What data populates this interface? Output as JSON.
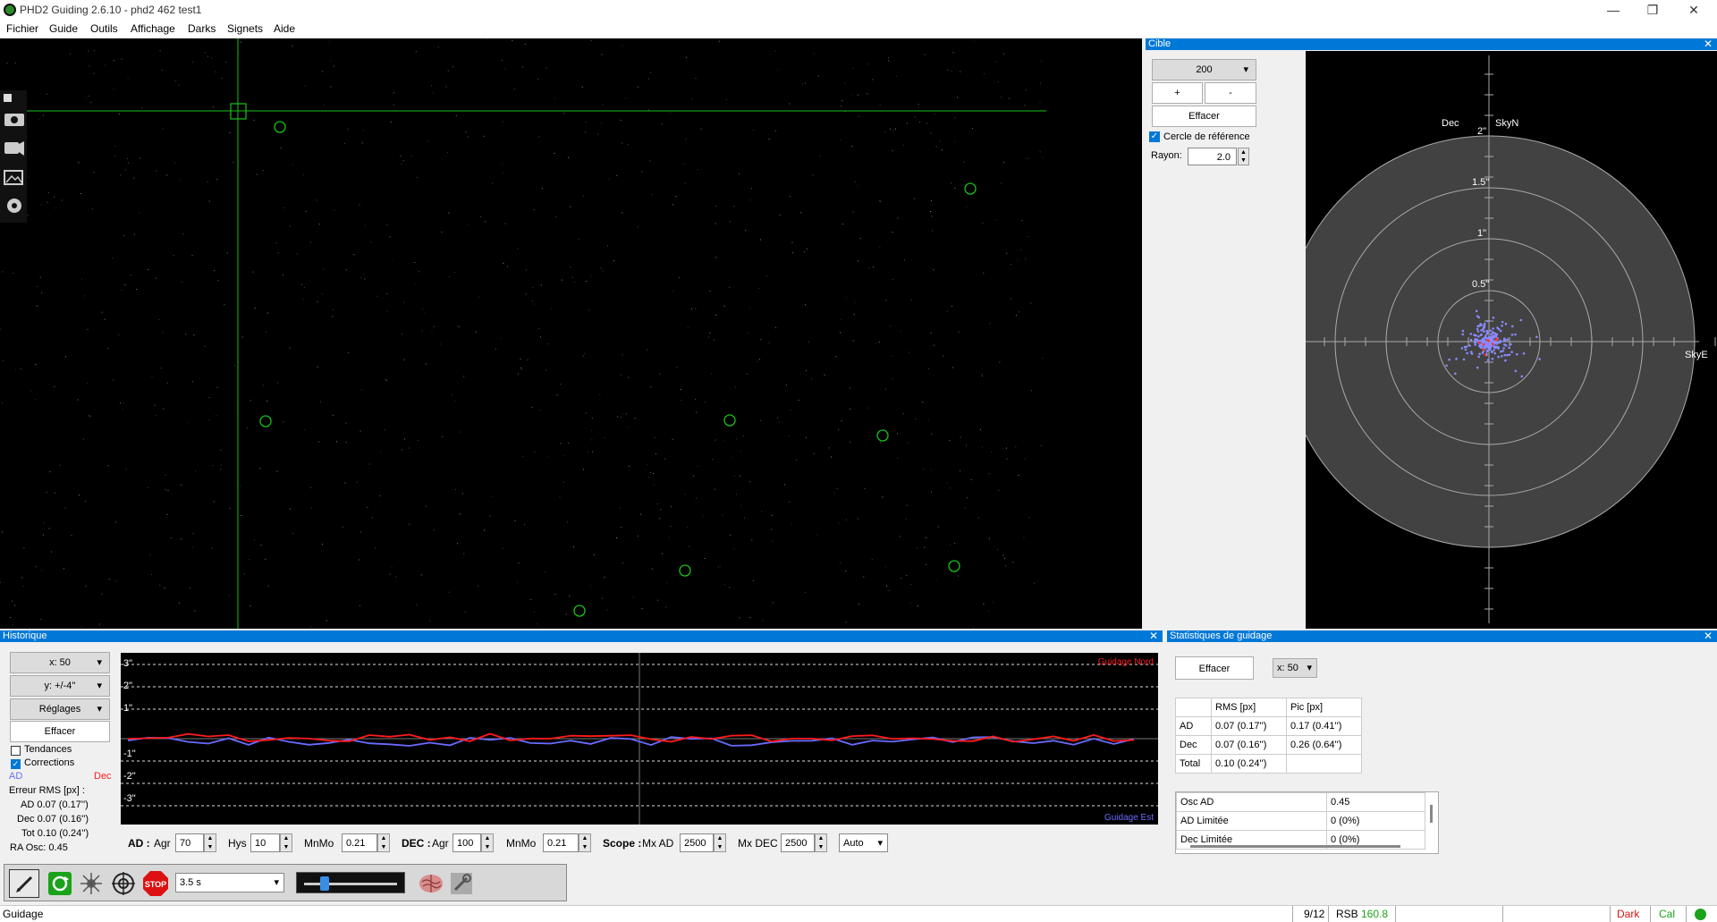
{
  "window": {
    "title": "PHD2 Guiding 2.6.10 - phd2 462 test1",
    "minimize": "—",
    "restore": "❐",
    "close": "✕"
  },
  "menu": [
    "Fichier",
    "Guide",
    "Outils",
    "Affichage",
    "Darks",
    "Signets",
    "Aide"
  ],
  "target": {
    "title": "Cible",
    "scale_value": "200",
    "plus_label": "+",
    "minus_label": "-",
    "clear_label": "Effacer",
    "ref_circle_label": "Cercle de référence",
    "ref_circle_checked": true,
    "radius_label": "Rayon:",
    "radius_value": "2.0",
    "labels": {
      "dec": "Dec",
      "skyn": "SkyN",
      "ad": "AD",
      "skye": "SkyE"
    },
    "rings": [
      "2\"",
      "1.5\"",
      "1\"",
      "0.5\""
    ]
  },
  "history": {
    "title": "Historique",
    "x_select": "x:  50",
    "y_select": "y: +/-4''",
    "settings_label": "Réglages",
    "clear_label": "Effacer",
    "trends_label": "Tendances",
    "trends_checked": false,
    "corrections_label": "Corrections",
    "corrections_checked": true,
    "legend_ad": "AD",
    "legend_dec": "Dec",
    "rms_title": "Erreur RMS [px] :",
    "rms_ad": "AD  0.07 (0.17'')",
    "rms_dec": "Dec  0.07 (0.16'')",
    "rms_tot": "Tot  0.10 (0.24'')",
    "ra_osc": "RA Osc: 0.45",
    "y_ticks": [
      "3\"",
      "2\"",
      "1\"",
      "-1\"",
      "-2\"",
      "-3\""
    ],
    "north_label": "Guidage Nord",
    "east_label": "Guidage Est",
    "colors": {
      "ra": "#6b6bff",
      "dec": "#ff1a1a"
    }
  },
  "params": {
    "ad_label": "AD :",
    "agr_label": "Agr",
    "ad_agr": "70",
    "hys_label": "Hys",
    "hys": "10",
    "mnmo_label": "MnMo",
    "ad_mnmo": "0.21",
    "dec_label": "DEC :",
    "dec_agr": "100",
    "dec_mnmo": "0.21",
    "scope_label": "Scope :",
    "mxad_label": "Mx AD",
    "mxad": "2500",
    "mxdec_label": "Mx DEC",
    "mxdec": "2500",
    "mode": "Auto"
  },
  "stats": {
    "title": "Statistiques de guidage",
    "clear_label": "Effacer",
    "x_select": "x: 50",
    "headers": [
      "",
      "RMS [px]",
      "Pic [px]"
    ],
    "rows": [
      [
        "AD",
        "0.07 (0.17'')",
        "0.17 (0.41'')"
      ],
      [
        "Dec",
        "0.07 (0.16'')",
        "0.26 (0.64'')"
      ],
      [
        "Total",
        "0.10 (0.24'')",
        ""
      ]
    ],
    "osc_rows": [
      [
        "Osc AD",
        "0.45"
      ],
      [
        "AD Limitée",
        "0 (0%)"
      ],
      [
        "Dec Limitée",
        "0 (0%)"
      ]
    ]
  },
  "toolbar": {
    "exposure": "3.5 s",
    "gamma_fraction": 0.22
  },
  "status": {
    "mode": "Guidage",
    "frame": "9/12",
    "snr_label": "RSB",
    "snr_value": "160.8",
    "dark": "Dark",
    "cal": "Cal"
  }
}
